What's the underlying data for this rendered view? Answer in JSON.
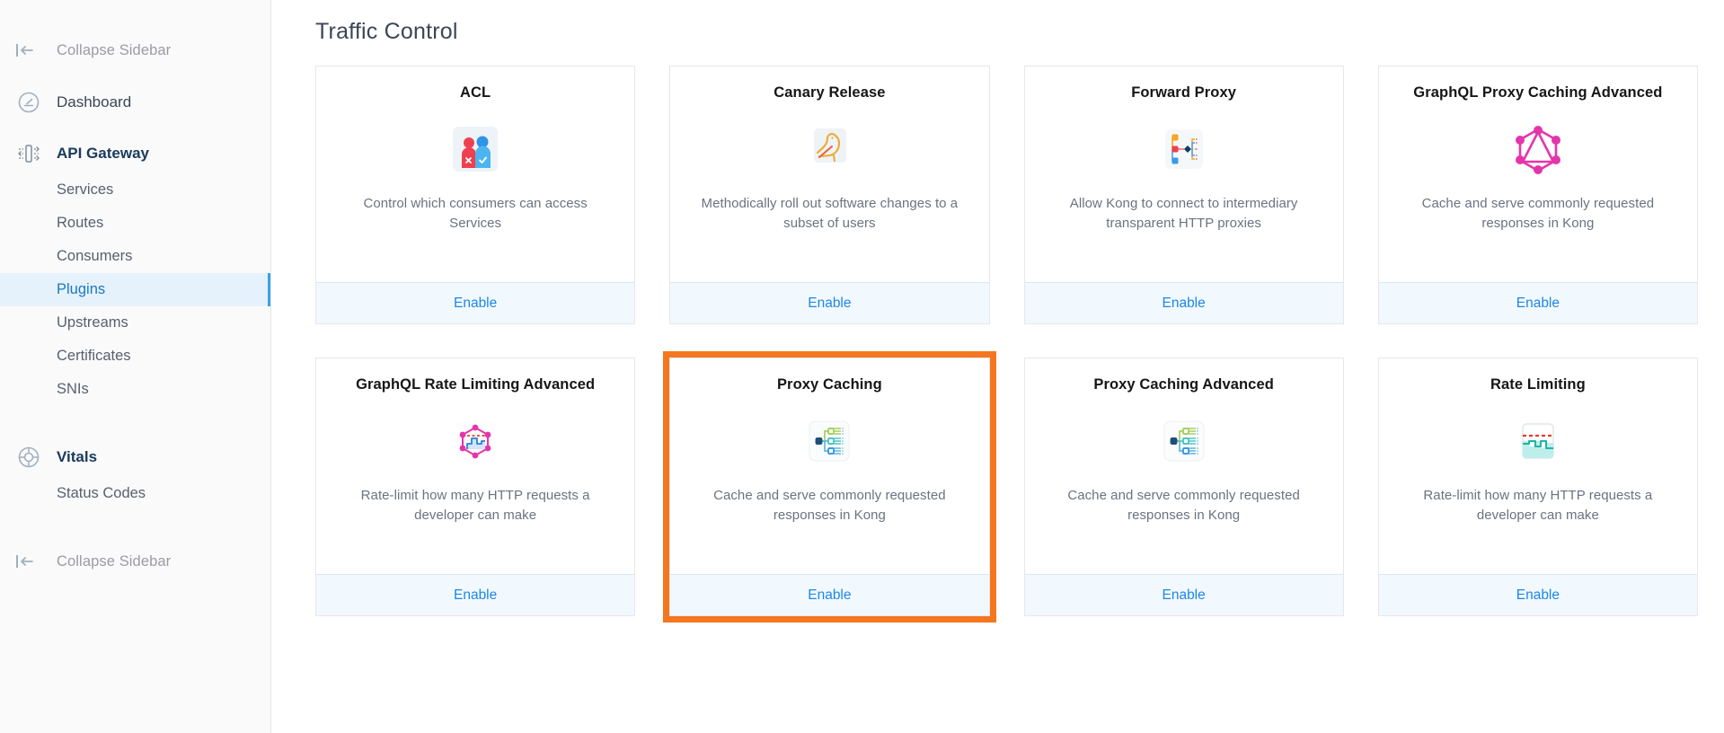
{
  "sidebar": {
    "collapse_top_label": "Collapse Sidebar",
    "collapse_bottom_label": "Collapse Sidebar",
    "dashboard_label": "Dashboard",
    "api_gateway_label": "API Gateway",
    "gateway_items": [
      {
        "label": "Services"
      },
      {
        "label": "Routes"
      },
      {
        "label": "Consumers"
      },
      {
        "label": "Plugins"
      },
      {
        "label": "Upstreams"
      },
      {
        "label": "Certificates"
      },
      {
        "label": "SNIs"
      }
    ],
    "vitals_label": "Vitals",
    "vitals_items": [
      {
        "label": "Status Codes"
      }
    ],
    "active_item": "Plugins",
    "active_bg": "#e5f2fb",
    "active_accent": "#3ba0e8"
  },
  "main": {
    "page_title": "Traffic Control",
    "enable_label": "Enable",
    "highlight_color": "#f4761f",
    "cards": [
      {
        "title": "ACL",
        "description": "Control which consumers can access Services",
        "icon": "acl-users-icon",
        "enable_label": "Enable",
        "highlighted": false
      },
      {
        "title": "Canary Release",
        "description": "Methodically roll out software changes to a subset of users",
        "icon": "canary-bird-icon",
        "enable_label": "Enable",
        "highlighted": false
      },
      {
        "title": "Forward Proxy",
        "description": "Allow Kong to connect to intermediary transparent HTTP proxies",
        "icon": "forward-proxy-node-icon",
        "enable_label": "Enable",
        "highlighted": false
      },
      {
        "title": "GraphQL Proxy Caching Advanced",
        "description": "Cache and serve commonly requested responses in Kong",
        "icon": "graphql-logo-icon",
        "enable_label": "Enable",
        "highlighted": false
      },
      {
        "title": "GraphQL Rate Limiting Advanced",
        "description": "Rate-limit how many HTTP requests a developer can make",
        "icon": "graphql-rate-limit-icon",
        "enable_label": "Enable",
        "highlighted": false
      },
      {
        "title": "Proxy Caching",
        "description": "Cache and serve commonly requested responses in Kong",
        "icon": "proxy-caching-tree-icon",
        "enable_label": "Enable",
        "highlighted": true
      },
      {
        "title": "Proxy Caching Advanced",
        "description": "Cache and serve commonly requested responses in Kong",
        "icon": "proxy-caching-tree-icon",
        "enable_label": "Enable",
        "highlighted": false
      },
      {
        "title": "Rate Limiting",
        "description": "Rate-limit how many HTTP requests a developer can make",
        "icon": "rate-limiting-wave-icon",
        "enable_label": "Enable",
        "highlighted": false
      }
    ]
  }
}
